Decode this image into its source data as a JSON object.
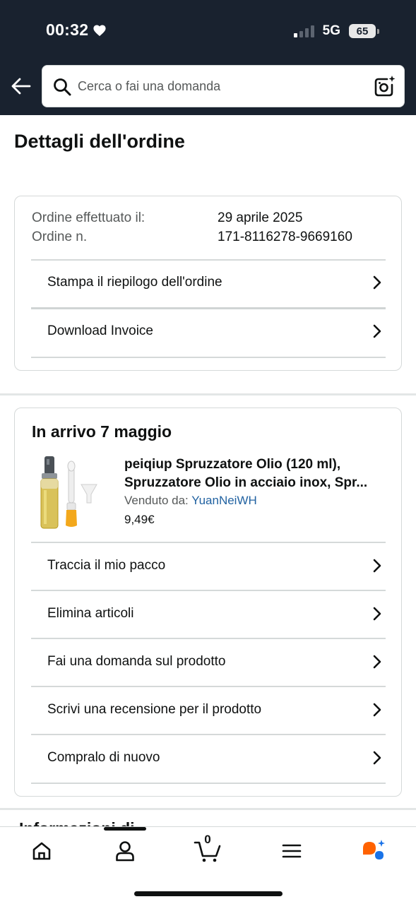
{
  "status_bar": {
    "time": "00:32",
    "network": "5G",
    "battery": "65"
  },
  "search": {
    "placeholder": "Cerca o fai una domanda"
  },
  "page": {
    "title": "Dettagli dell'ordine"
  },
  "order": {
    "date_label": "Ordine effettuato il:",
    "date_value": "29 aprile 2025",
    "number_label": "Ordine n.",
    "number_value": "171-8116278-9669160",
    "actions": [
      {
        "label": "Stampa il riepilogo dell'ordine"
      },
      {
        "label": "Download Invoice"
      }
    ]
  },
  "shipment": {
    "arrival": "In arrivo 7 maggio",
    "product": {
      "title_line1": "peiqiup Spruzzatore Olio (120 ml),",
      "title_line2": "Spruzzatore Olio in acciaio inox, Spr...",
      "seller_label": "Venduto da:",
      "seller_name": "YuanNeiWH",
      "price": "9,49€"
    },
    "actions": [
      {
        "label": "Traccia il mio pacco"
      },
      {
        "label": "Elimina articoli"
      },
      {
        "label": "Fai una domanda sul prodotto"
      },
      {
        "label": "Scrivi una recensione per il prodotto"
      },
      {
        "label": "Compralo di nuovo"
      }
    ]
  },
  "next_section_peek": "Informazioni di",
  "tabbar": {
    "cart_count": "0",
    "tabs": [
      "home-icon",
      "account-icon",
      "cart-icon",
      "menu-icon",
      "rufus-icon"
    ]
  },
  "colors": {
    "header_bg": "#19222f",
    "link": "#2162a1",
    "rufus_orange": "#ff6200",
    "rufus_blue": "#1a73e8"
  }
}
